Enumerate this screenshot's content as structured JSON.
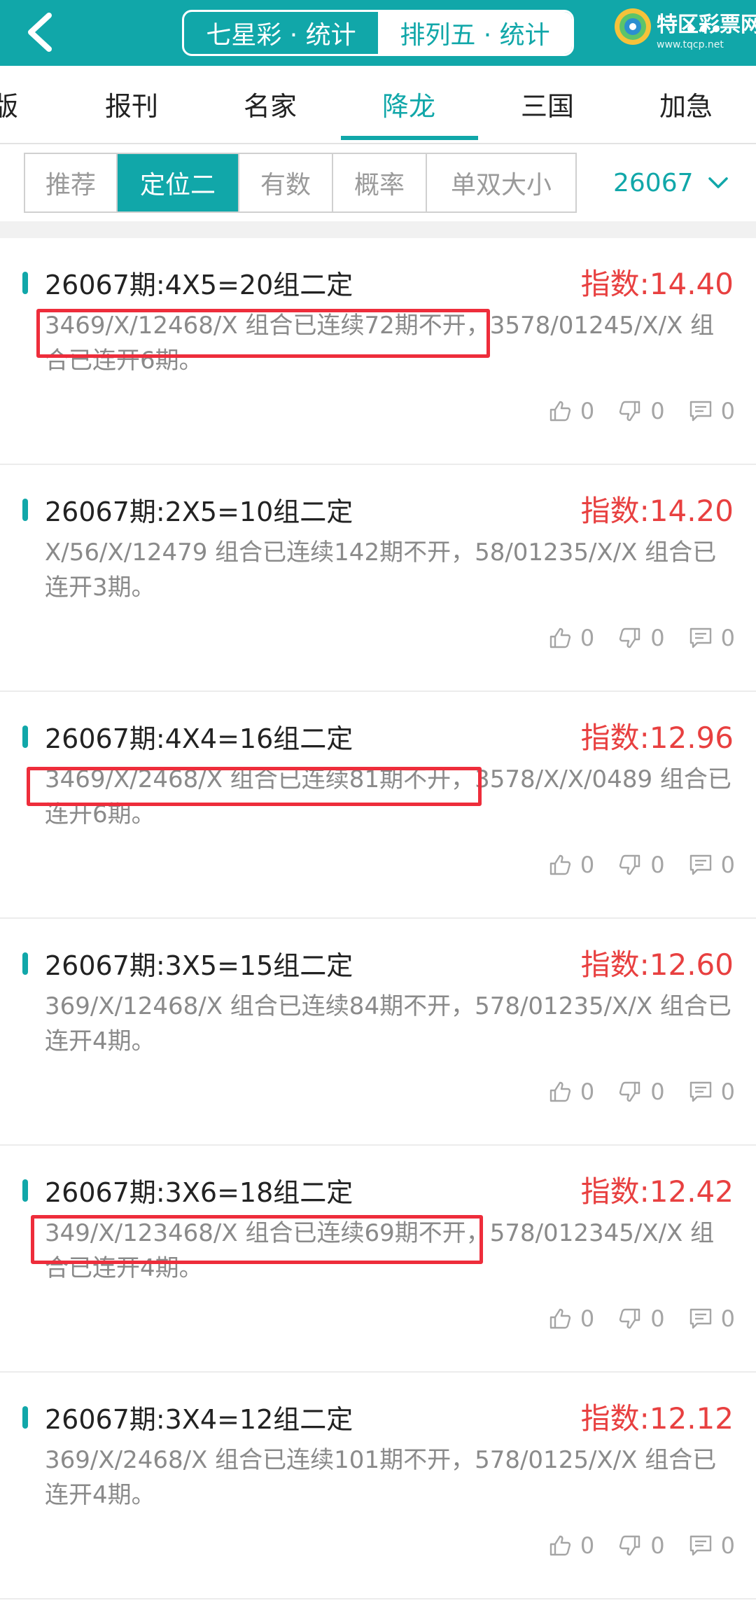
{
  "header": {
    "segments": [
      {
        "label": "七星彩 · 统计",
        "active": false
      },
      {
        "label": "排列五 · 统计",
        "active": true
      }
    ],
    "logo_text": "特区彩票网",
    "logo_url": "www.tqcp.net"
  },
  "categories": [
    "版",
    "报刊",
    "名家",
    "降龙",
    "三国",
    "加急"
  ],
  "active_category": "降龙",
  "subtabs": [
    "推荐",
    "定位二",
    "有数",
    "概率",
    "单双大小"
  ],
  "active_subtab": "定位二",
  "period": "26067",
  "posts": [
    {
      "title": "26067期:4X5=20组二定",
      "index": "指数:14.40",
      "body": "3469/X/12468/X 组合已连续72期不开，3578/01245/X/X 组合已连开6期。",
      "likes": "0",
      "dislikes": "0",
      "comments": "0"
    },
    {
      "title": "26067期:2X5=10组二定",
      "index": "指数:14.20",
      "body": "X/56/X/12479 组合已连续142期不开，58/01235/X/X 组合已连开3期。",
      "likes": "0",
      "dislikes": "0",
      "comments": "0"
    },
    {
      "title": "26067期:4X4=16组二定",
      "index": "指数:12.96",
      "body": "3469/X/2468/X 组合已连续81期不开，3578/X/X/0489 组合已连开6期。",
      "likes": "0",
      "dislikes": "0",
      "comments": "0"
    },
    {
      "title": "26067期:3X5=15组二定",
      "index": "指数:12.60",
      "body": "369/X/12468/X 组合已连续84期不开，578/01235/X/X 组合已连开4期。",
      "likes": "0",
      "dislikes": "0",
      "comments": "0"
    },
    {
      "title": "26067期:3X6=18组二定",
      "index": "指数:12.42",
      "body": "349/X/123468/X 组合已连续69期不开，578/012345/X/X 组合已连开4期。",
      "likes": "0",
      "dislikes": "0",
      "comments": "0"
    },
    {
      "title": "26067期:3X4=12组二定",
      "index": "指数:12.12",
      "body": "369/X/2468/X 组合已连续101期不开，578/0125/X/X 组合已连开4期。",
      "likes": "0",
      "dislikes": "0",
      "comments": "0"
    }
  ],
  "colors": {
    "accent": "#11a7a9",
    "index_red": "#e84040",
    "highlight_box": "#ee2d3b"
  }
}
